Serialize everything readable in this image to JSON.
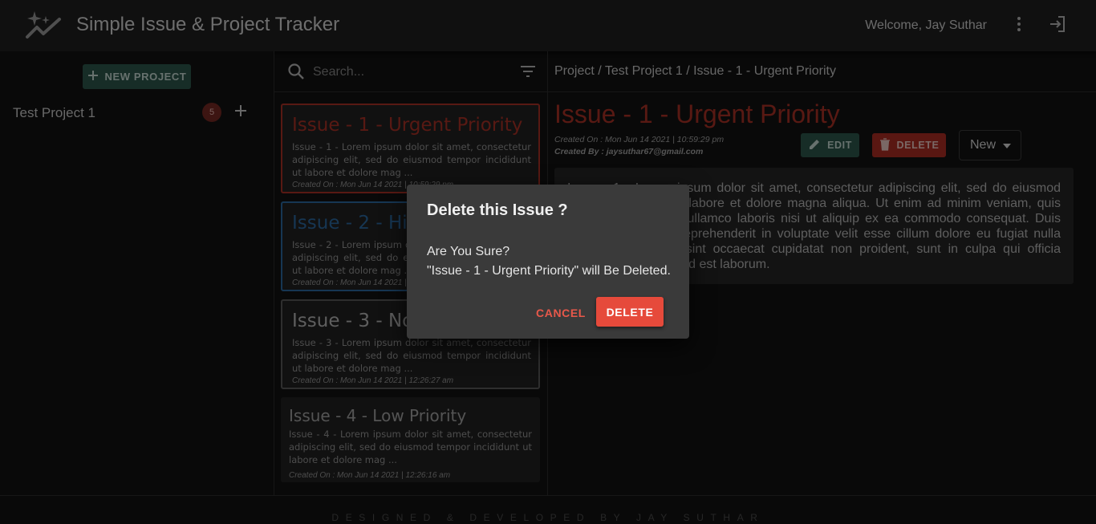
{
  "app": {
    "title": "Simple Issue & Project Tracker",
    "welcome": "Welcome, Jay Suthar"
  },
  "sidebar": {
    "new_project_label": "NEW PROJECT",
    "projects": [
      {
        "name": "Test Project 1",
        "issue_count": "5"
      }
    ]
  },
  "search": {
    "placeholder": "Search..."
  },
  "issues": [
    {
      "title": "Issue - 1 - Urgent Priority",
      "desc": "Issue - 1 - Lorem ipsum dolor sit amet, consectetur adipiscing elit, sed do eiusmod tempor incididunt ut labore et dolore mag ...",
      "created": "Created On : Mon Jun 14 2021 | 10:59:29 pm",
      "color": "#b13327"
    },
    {
      "title": "Issue - 2 - High Priority",
      "desc": "Issue - 2 - Lorem ipsum dolor sit amet, consectetur adipiscing elit, sed do eiusmod tempor incididunt ut labore et dolore mag ...",
      "created": "Created On : Mon Jun 14 2021 | 10:59:29 pm",
      "color": "#2d6da6"
    },
    {
      "title": "Issue - 3 - Normal Priority",
      "desc": "Issue - 3 - Lorem ipsum dolor sit amet, consectetur adipiscing elit, sed do eiusmod tempor incididunt ut labore et dolore mag ...",
      "created": "Created On : Mon Jun 14 2021 | 12:26:27 am",
      "color": "#5c5c5c"
    },
    {
      "title": "Issue - 4 - Low Priority",
      "desc": "Issue - 4 - Lorem ipsum dolor sit amet, consectetur adipiscing elit, sed do eiusmod tempor incididunt ut labore et dolore mag ...",
      "created": "Created On : Mon Jun 14 2021 | 12:26:16 am",
      "color": "#232323"
    }
  ],
  "detail": {
    "breadcrumb": "Project / Test Project 1 / Issue - 1 - Urgent Priority",
    "title": "Issue - 1 - Urgent Priority",
    "created_on": "Created On : Mon Jun 14 2021 | 10:59:29 pm",
    "created_by": "Created By : jaysuthar67@gmail.com",
    "edit_label": "EDIT",
    "delete_label": "DELETE",
    "status": "New",
    "description": "Issue - 1 - Lorem ipsum dolor sit amet, consectetur adipiscing elit, sed do eiusmod tempor incididunt ut labore et dolore magna aliqua. Ut enim ad minim veniam, quis nostrud exercitation ullamco laboris nisi ut aliquip ex ea commodo consequat. Duis aute irure dolor in reprehenderit in voluptate velit esse cillum dolore eu fugiat nulla pariatur. Excepteur sint occaecat cupidatat non proident, sunt in culpa qui officia deserunt mollit anim id est laborum."
  },
  "dialog": {
    "title": "Delete this Issue ?",
    "question": "Are You Sure?",
    "message": "\"Issue - 1 - Urgent Priority\" will Be Deleted.",
    "cancel_label": "CANCEL",
    "confirm_label": "DELETE"
  },
  "footer": {
    "text": "DESIGNED & DEVELOPED BY JAY SUTHAR"
  },
  "colors": {
    "accent_green": "#2e5a4f",
    "danger": "#e64a3b",
    "urgent": "#b13327",
    "high": "#2d6da6"
  }
}
